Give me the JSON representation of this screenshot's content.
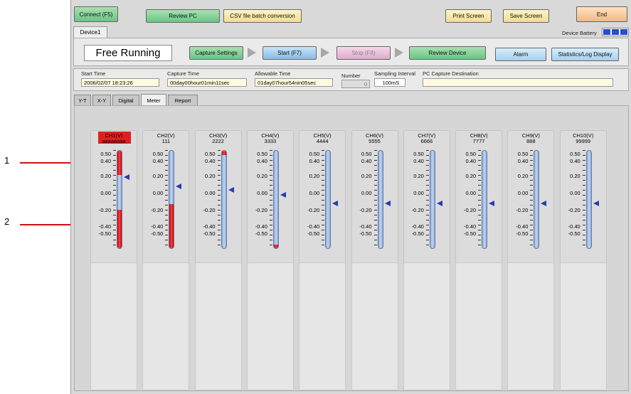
{
  "callouts": {
    "one": "1",
    "two": "2"
  },
  "toolbar": {
    "connect": "Connect (F5)",
    "review_pc": "Review PC",
    "csv": "CSV file batch conversion",
    "print": "Print Screen",
    "save": "Save Screen",
    "end": "End"
  },
  "device_tab": "Device1",
  "battery_label": "Device Battery",
  "status": "Free Running",
  "controls": {
    "capture_settings": "Capture Settings",
    "start": "Start (F7)",
    "stop": "Stop (F8)",
    "review_device": "Review Device",
    "alarm": "Alarm",
    "stats": "Statistics/Log Display"
  },
  "info": {
    "start_time_label": "Start Time",
    "start_time": "2006/02/07 18:23:26",
    "capture_time_label": "Capture Time",
    "capture_time": "00day00hour01min11sec",
    "allowable_time_label": "Allowable Time",
    "allowable_time": "01day07hour54nin05sec",
    "number_label": "Number",
    "number": "0",
    "sampling_label": "Sampling Interval",
    "sampling": "100mS",
    "dest_label": "PC Capture Destination",
    "dest": ""
  },
  "tabs": [
    "Y-T",
    "X-Y",
    "Digital",
    "Meter",
    "Report"
  ],
  "active_tab": "Meter",
  "scale_labels": [
    "0.50",
    "0.40",
    "0.20",
    "0.00",
    "-0.20",
    "-0.40",
    "-0.50"
  ],
  "channels": [
    {
      "name": "CH1(V)",
      "value": "aaaaaaaa",
      "alarm": true
    },
    {
      "name": "CH2(V)",
      "value": "111"
    },
    {
      "name": "CH3(V)",
      "value": "2222"
    },
    {
      "name": "CH4(V)",
      "value": "3333"
    },
    {
      "name": "CH5(V)",
      "value": "4444"
    },
    {
      "name": "CH6(V)",
      "value": "5555"
    },
    {
      "name": "CH7(V)",
      "value": "6666"
    },
    {
      "name": "CH8(V)",
      "value": "7777"
    },
    {
      "name": "CH9(V)",
      "value": "888"
    },
    {
      "name": "CH10(V)",
      "value": "99999"
    }
  ],
  "colors": {
    "alarm": "#e02020",
    "pointer": "#2a3ab0",
    "tube": "#9ab4e0"
  }
}
